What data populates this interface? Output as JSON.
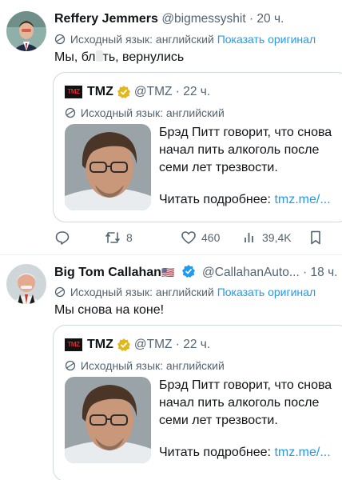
{
  "tweets": [
    {
      "name": "Reffery Jemmers",
      "handle_time": "@bigmessyshit · 20 ч.",
      "translation_label": "Исходный язык: английский",
      "translation_link": "Показать оригинал",
      "text_before_censor": "Мы, бл",
      "text_after_censor": "ть, вернулись"
    },
    {
      "name": "Big Tom Callahan",
      "flag": "🇺🇸",
      "handle_time": "@CallahanAuto... · 18 ч.",
      "translation_label": "Исходный язык: английский",
      "translation_link": "Показать оригинал",
      "text": "Мы снова на коне!"
    }
  ],
  "quote": {
    "logo": "TMZ",
    "name": "TMZ",
    "handle_time": "@TMZ · 22 ч.",
    "translation_label": "Исходный язык: английский",
    "lines": [
      "Брэд Питт говорит, что снова",
      "начал пить алкоголь после",
      "семи лет трезвости."
    ],
    "read_more_label": "Читать подробнее:",
    "read_more_link": "tmz.me/..."
  },
  "actions": {
    "reply_icon": "reply-icon",
    "retweet_icon": "retweet-icon",
    "retweet_count": "8",
    "like_icon": "heart-icon",
    "like_count": "460",
    "views_icon": "views-icon",
    "views_count": "39,4K",
    "bookmark_icon": "bookmark-icon"
  },
  "colors": {
    "link": "#1d9bf0",
    "muted": "#536471",
    "text": "#0f1419",
    "verified_gold": "#e2b719",
    "verified_blue": "#1d9bf0",
    "tmz_red": "#e0262f"
  }
}
